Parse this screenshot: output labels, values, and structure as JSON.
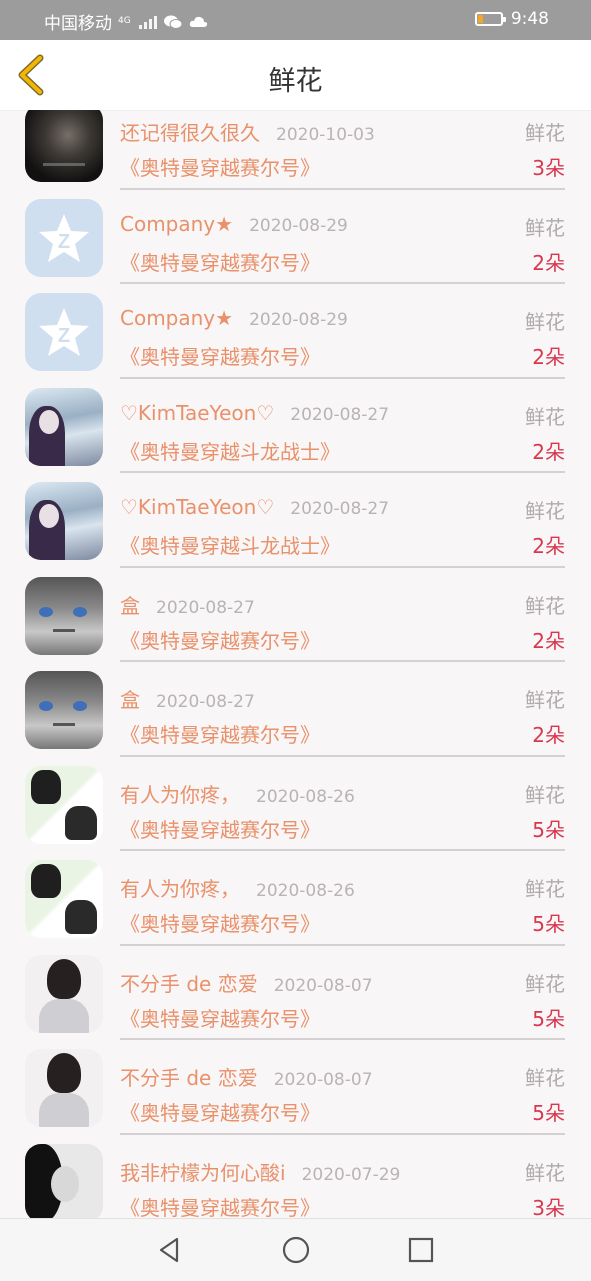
{
  "status_bar": {
    "carrier": "中国移动",
    "network": "4G",
    "time": "9:48",
    "battery_level": 0.2,
    "battery_color": "#f5a623"
  },
  "header": {
    "title": "鲜花",
    "back_icon": "chevron-left-icon"
  },
  "list": [
    {
      "name": "还记得很久很久",
      "date": "2020-10-03",
      "type": "鲜花",
      "book": "《奥特曼穿越赛尔号》",
      "count": "3朵",
      "avatar": "dark-photo"
    },
    {
      "name": "Company★",
      "date": "2020-08-29",
      "type": "鲜花",
      "book": "《奥特曼穿越赛尔号》",
      "count": "2朵",
      "avatar": "qq-default"
    },
    {
      "name": "Company★",
      "date": "2020-08-29",
      "type": "鲜花",
      "book": "《奥特曼穿越赛尔号》",
      "count": "2朵",
      "avatar": "qq-default"
    },
    {
      "name": "♡KimTaeYeon♡",
      "date": "2020-08-27",
      "type": "鲜花",
      "book": "《奥特曼穿越斗龙战士》",
      "count": "2朵",
      "avatar": "girl-photo"
    },
    {
      "name": "♡KimTaeYeon♡",
      "date": "2020-08-27",
      "type": "鲜花",
      "book": "《奥特曼穿越斗龙战士》",
      "count": "2朵",
      "avatar": "girl-photo"
    },
    {
      "name": "盒",
      "date": "2020-08-27",
      "type": "鲜花",
      "book": "《奥特曼穿越赛尔号》",
      "count": "2朵",
      "avatar": "anime-photo"
    },
    {
      "name": "盒",
      "date": "2020-08-27",
      "type": "鲜花",
      "book": "《奥特曼穿越赛尔号》",
      "count": "2朵",
      "avatar": "anime-photo"
    },
    {
      "name": "有人为你疼，",
      "date": "2020-08-26",
      "type": "鲜花",
      "book": "《奥特曼穿越赛尔号》",
      "count": "5朵",
      "avatar": "collage-photo"
    },
    {
      "name": "有人为你疼，",
      "date": "2020-08-26",
      "type": "鲜花",
      "book": "《奥特曼穿越赛尔号》",
      "count": "5朵",
      "avatar": "collage-photo"
    },
    {
      "name": "不分手 de 恋爱",
      "date": "2020-08-07",
      "type": "鲜花",
      "book": "《奥特曼穿越赛尔号》",
      "count": "5朵",
      "avatar": "selfie-photo"
    },
    {
      "name": "不分手 de 恋爱",
      "date": "2020-08-07",
      "type": "鲜花",
      "book": "《奥特曼穿越赛尔号》",
      "count": "5朵",
      "avatar": "selfie-photo"
    },
    {
      "name": "我非柠檬为何心酸i",
      "date": "2020-07-29",
      "type": "鲜花",
      "book": "《奥特曼穿越赛尔号》",
      "count": "3朵",
      "avatar": "bw-photo"
    }
  ],
  "nav_bar": {
    "back": "triangle-back-icon",
    "home": "circle-home-icon",
    "recents": "square-recents-icon"
  },
  "colors": {
    "accent": "#e8916a",
    "count": "#d8374f",
    "back_arrow": "#f2b705"
  }
}
